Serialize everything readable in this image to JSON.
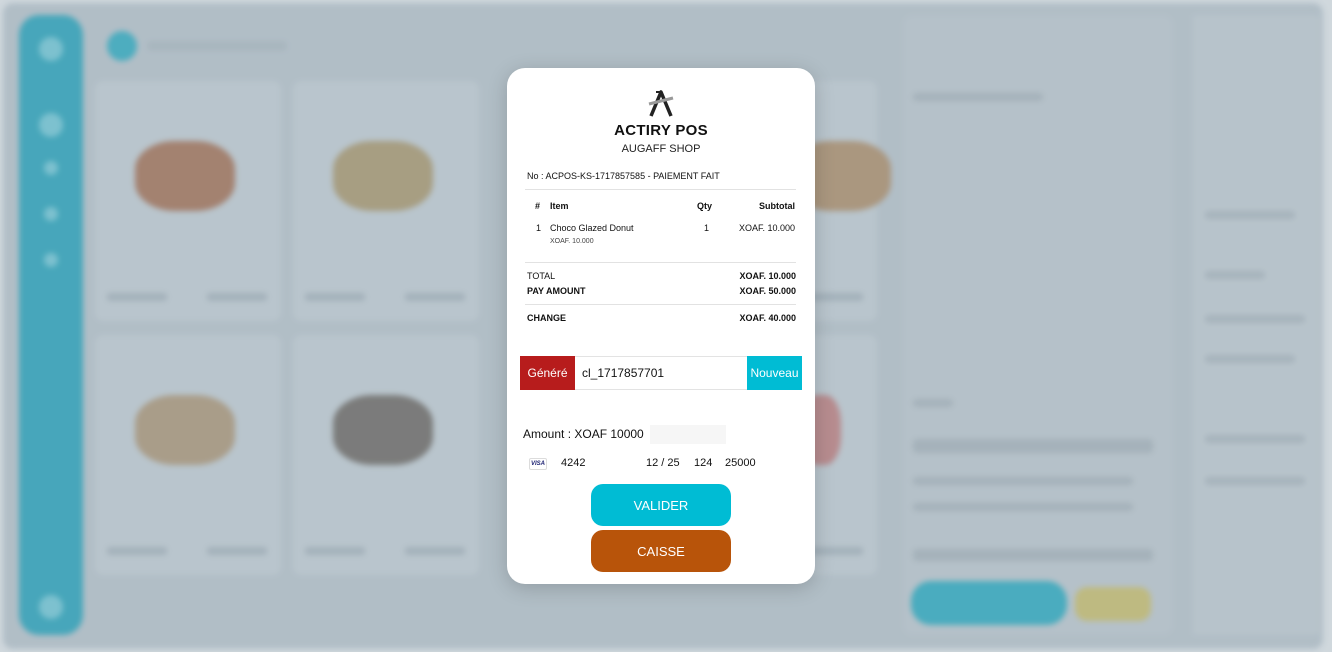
{
  "receipt": {
    "brand": "ACTIRY POS",
    "shop": "AUGAFF SHOP",
    "number_line": "No : ACPOS-KS-1717857585 - PAIEMENT FAIT",
    "columns": {
      "index": "#",
      "item": "Item",
      "qty": "Qty",
      "subtotal": "Subtotal"
    },
    "items": [
      {
        "index": "1",
        "name": "Choco Glazed Donut",
        "unit_price": "XOAF. 10.000",
        "qty": "1",
        "subtotal": "XOAF. 10.000"
      }
    ],
    "total_label": "TOTAL",
    "total_value": "XOAF. 10.000",
    "pay_label": "PAY AMOUNT",
    "pay_value": "XOAF. 50.000",
    "change_label": "CHANGE",
    "change_value": "XOAF. 40.000"
  },
  "client": {
    "generate_label": "Généré",
    "id_value": "cl_1717857701",
    "new_label": "Nouveau"
  },
  "payment": {
    "amount_text": "Amount : XOAF 10000",
    "card_brand": "VISA",
    "card_last4": "4242",
    "card_expiry": "12 / 25",
    "card_cvc": "124",
    "card_zip": "25000"
  },
  "actions": {
    "validate_label": "VALIDER",
    "cashier_label": "CAISSE"
  },
  "icons": {
    "logo": "actiry-logo-icon",
    "card": "visa-card-icon"
  },
  "colors": {
    "accent": "#00bcd4",
    "danger": "#b71c1c",
    "cashier": "#b8540a"
  }
}
